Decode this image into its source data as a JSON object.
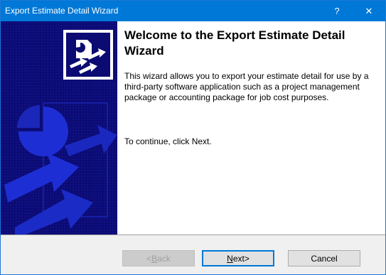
{
  "window": {
    "title": "Export Estimate Detail Wizard",
    "help_glyph": "?",
    "close_glyph": "✕"
  },
  "content": {
    "heading": "Welcome to the Export Estimate Detail Wizard",
    "description": "This wizard allows you to export your estimate detail for use by a third-party software application such as a project management package or accounting package for job cost purposes.",
    "continue_text": "To continue, click Next."
  },
  "buttons": {
    "back": {
      "mnemonic": "B",
      "rest": "ack",
      "prefix": "< ",
      "suffix": ""
    },
    "next": {
      "mnemonic": "N",
      "rest": "ext",
      "prefix": "",
      "suffix": " >"
    },
    "cancel": "Cancel"
  },
  "colors": {
    "titlebar": "#0078d7",
    "side_panel": "#0b0b73",
    "side_art": "#1a2ad1"
  }
}
